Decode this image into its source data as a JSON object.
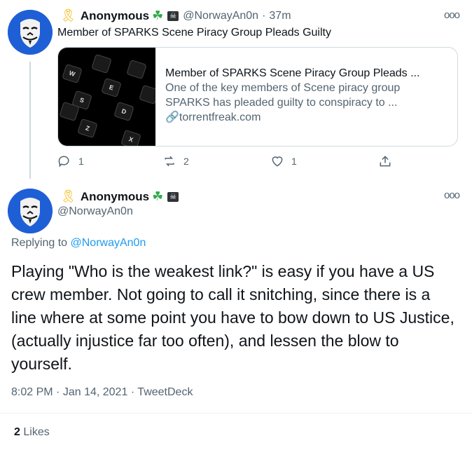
{
  "parent_tweet": {
    "display_name": "Anonymous",
    "handle": "@NorwayAn0n",
    "time_ago": "37m",
    "text": "Member of SPARKS Scene Piracy Group Pleads Guilty",
    "card": {
      "title": "Member of SPARKS Scene Piracy Group Pleads ...",
      "description": "One of the key members of Scene piracy group SPARKS has pleaded guilty to conspiracy to ...",
      "domain": "torrentfreak.com",
      "image_keys": [
        "W",
        "E",
        "S",
        "D",
        "Z",
        "X"
      ]
    },
    "actions": {
      "replies": "1",
      "retweets": "2",
      "likes": "1"
    }
  },
  "main_tweet": {
    "display_name": "Anonymous",
    "handle": "@NorwayAn0n",
    "replying_label": "Replying to",
    "replying_to": "@NorwayAn0n",
    "text": "Playing \"Who is the weakest link?\" is easy if you have a US crew member. Not going to call it snitching, since there is a line where at some point you have to bow down to US Justice, (actually injustice far too often), and lessen the blow to yourself.",
    "time": "8:02 PM",
    "date": "Jan 14, 2021",
    "source": "TweetDeck",
    "likes_count": "2",
    "likes_label": "Likes"
  },
  "icons": {
    "ribbon": "ribbon-icon",
    "clover": "clover-icon",
    "pirate_flag": "pirate-flag-icon",
    "more": "more-icon",
    "reply": "reply-icon",
    "retweet": "retweet-icon",
    "like": "heart-icon",
    "share": "share-icon",
    "link": "link-icon"
  },
  "colors": {
    "link": "#1d9bf0",
    "muted": "#536471",
    "text": "#0f1419",
    "avatar_bg": "#1f5fd6"
  }
}
